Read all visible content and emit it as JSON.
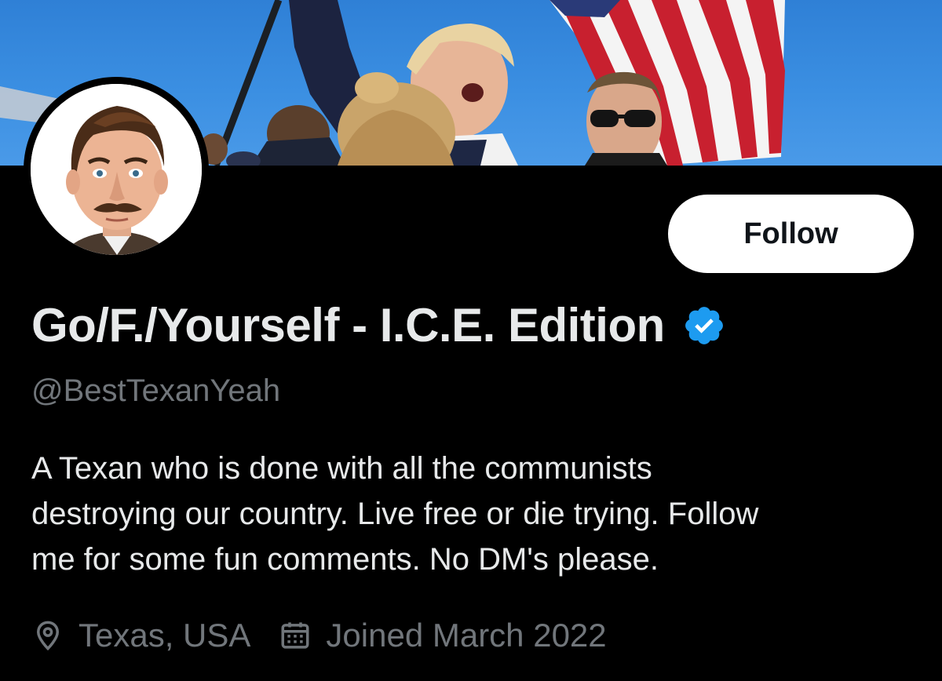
{
  "profile": {
    "follow_label": "Follow",
    "display_name": "Go/F./Yourself - I.C.E. Edition",
    "handle": "@BestTexanYeah",
    "bio_lines": [
      "A Texan who is done with all the communists",
      "destroying our country. Live free or die trying. Follow",
      "me for some fun comments. No DM's please."
    ],
    "location": "Texas, USA",
    "joined": "Joined March 2022"
  },
  "icons": {
    "verified": "verified-badge-icon",
    "location": "location-pin-icon",
    "calendar": "calendar-icon"
  },
  "colors": {
    "background": "#000000",
    "primary_text": "#e7e9ea",
    "secondary_text": "#71767b",
    "verified_blue": "#1d9bf0",
    "follow_button_bg": "#ffffff",
    "follow_button_text": "#0f1419"
  }
}
